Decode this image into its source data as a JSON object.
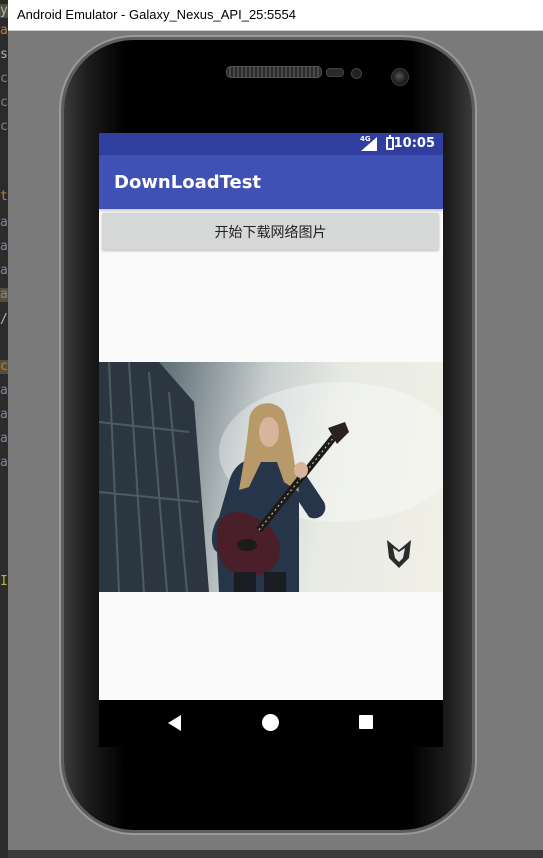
{
  "window": {
    "title": "Android Emulator - Galaxy_Nexus_API_25:5554"
  },
  "ide_background": {
    "visible_glyphs": [
      "y",
      "a",
      "s",
      "c",
      "c",
      "c",
      "t",
      "a",
      "a",
      "a",
      "a",
      "/",
      "c",
      "a",
      "a",
      "a",
      "a",
      "I"
    ]
  },
  "statusbar": {
    "time": "10:05",
    "network_label": "4G",
    "icons": [
      "signal-icon",
      "battery-icon"
    ]
  },
  "app": {
    "title": "DownLoadTest",
    "download_button_label": "开始下载网络图片",
    "image_description_icon": "downloaded-image"
  },
  "navbar": {
    "icons": [
      "back-icon",
      "home-icon",
      "recents-icon"
    ]
  },
  "colors": {
    "primary": "#3f51b5",
    "primary_dark": "#303f9f",
    "button": "#d6d7d7",
    "background": "#fafafa"
  }
}
